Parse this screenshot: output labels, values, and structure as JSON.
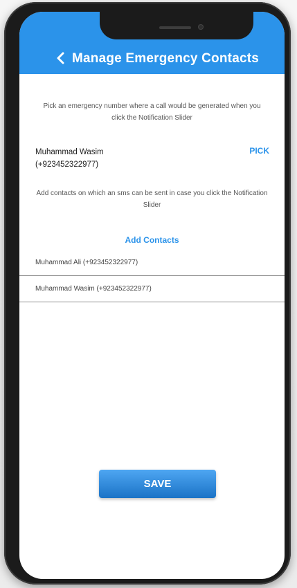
{
  "header": {
    "title": "Manage Emergency Contacts",
    "back_icon": "chevron-left-icon",
    "background_color": "#2b93ea"
  },
  "emergency_number": {
    "description": "Pick an emergency number where a call would be generated when you click the Notification Slider",
    "contact_name": "Muhammad Wasim",
    "contact_number": "(+923452322977)",
    "pick_label": "PICK"
  },
  "sms_contacts": {
    "description": "Add contacts on which an sms can be sent in case you click the Notification Slider",
    "add_label": "Add Contacts",
    "items": [
      {
        "label": "Muhammad Ali (+923452322977)"
      },
      {
        "label": "Muhammad Wasim (+923452322977)"
      }
    ]
  },
  "save_label": "SAVE",
  "colors": {
    "accent": "#2b93ea",
    "save_button": "#1f80d8"
  }
}
